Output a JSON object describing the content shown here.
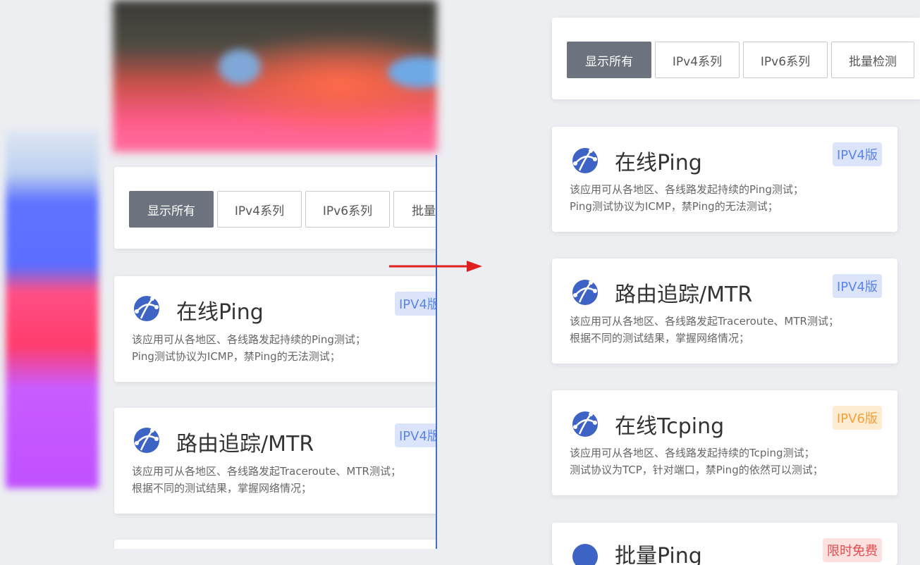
{
  "filters": [
    "显示所有",
    "IPv4系列",
    "IPv6系列",
    "批量检测"
  ],
  "left_filters_visible": [
    "显示所有",
    "IPv4系列",
    "IPv6系列",
    "批量"
  ],
  "cards": [
    {
      "title": "在线Ping",
      "badge": "IPV4版",
      "desc1": "该应用可从各地区、各线路发起持续的Ping测试；",
      "desc2": "Ping测试协议为ICMP，禁Ping的无法测试；"
    },
    {
      "title": "路由追踪/MTR",
      "badge": "IPV4版",
      "desc1": "该应用可从各地区、各线路发起Traceroute、MTR测试；",
      "desc2": "根据不同的测试结果，掌握网络情况；"
    },
    {
      "title": "在线Tcping",
      "badge": "IPV6版",
      "desc1": "该应用可从各地区、各线路发起持续的Tcping测试；",
      "desc2": "测试协议为TCP，针对端口，禁Ping的依然可以测试；"
    },
    {
      "title": "批量Ping",
      "badge": "限时免费",
      "desc1": "",
      "desc2": ""
    }
  ],
  "left_badge_cut": "IPV4版",
  "colors": {
    "accent": "#6c737e",
    "icon_blue": "#3d63c4",
    "badge_v4": "#5b86e8",
    "badge_v6": "#f3a13a",
    "badge_free": "#e74c4c",
    "arrow": "#e02020"
  }
}
